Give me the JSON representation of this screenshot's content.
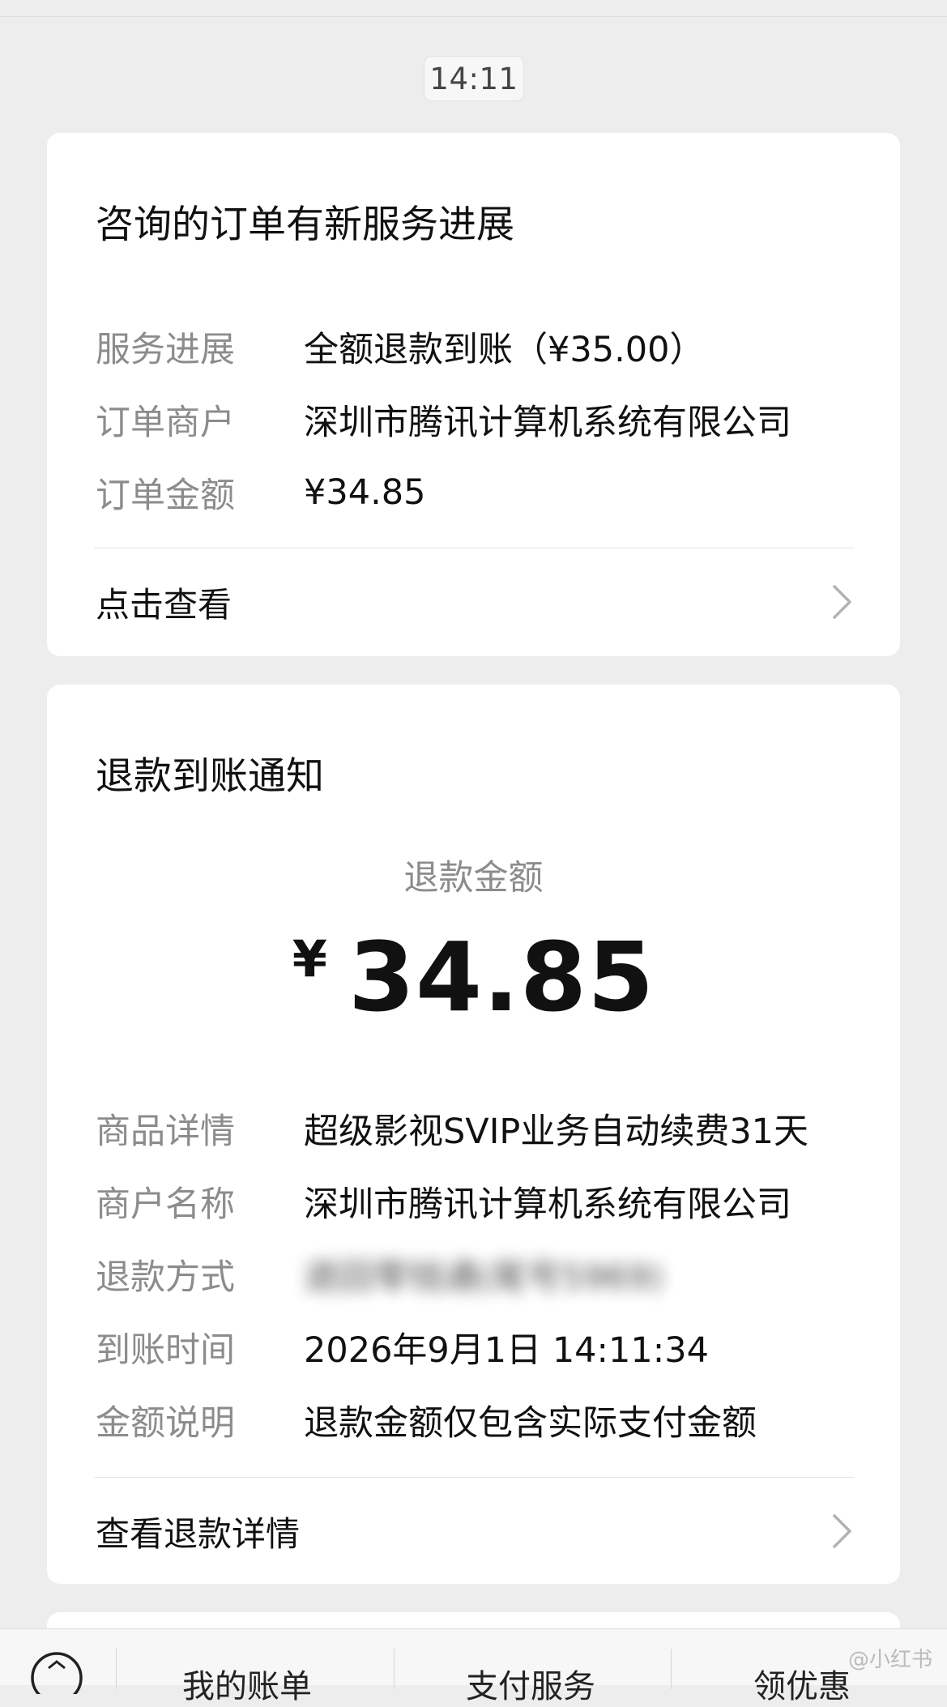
{
  "timestamp": "14:11",
  "service_card": {
    "title": "咨询的订单有新服务进展",
    "rows": [
      {
        "label": "服务进展",
        "value": "全额退款到账（¥35.00）"
      },
      {
        "label": "订单商户",
        "value": "深圳市腾讯计算机系统有限公司"
      },
      {
        "label": "订单金额",
        "value": "¥34.85"
      }
    ],
    "action_label": "点击查看"
  },
  "refund_card": {
    "title": "退款到账通知",
    "amount_label": "退款金额",
    "amount_currency": "¥",
    "amount_value": "34.85",
    "rows": [
      {
        "label": "商品详情",
        "value": "超级影视SVIP业务自动续费31天"
      },
      {
        "label": "商户名称",
        "value": "深圳市腾讯计算机系统有限公司"
      },
      {
        "label": "退款方式",
        "value": "退回零钱通(尾号5969)"
      },
      {
        "label": "到账时间",
        "value": "2026年9月1日 14:11:34"
      },
      {
        "label": "金额说明",
        "value": "退款金额仅包含实际支付金额"
      }
    ],
    "action_label": "查看退款详情"
  },
  "bottom_menu": {
    "items": [
      "我的账单",
      "支付服务",
      "领优惠"
    ]
  },
  "watermark": "@小红书"
}
